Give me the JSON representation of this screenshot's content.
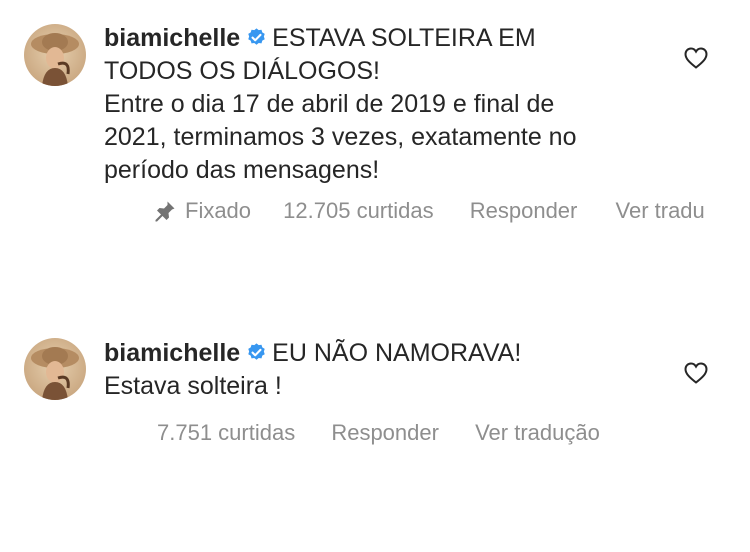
{
  "comments": [
    {
      "username": "biamichelle",
      "text_line1_tail": "ESTAVA SOLTEIRA EM",
      "text_line2": "TODOS OS DIÁLOGOS!",
      "text_line3": "Entre o dia 17 de abril de 2019 e final de",
      "text_line4": "2021, terminamos 3 vezes, exatamente no",
      "text_line5": "período das mensagens!",
      "pinned_label": "Fixado",
      "likes": "12.705 curtidas",
      "reply_label": "Responder",
      "translate_label": "Ver tradu"
    },
    {
      "username": "biamichelle",
      "text_line1_tail": "EU NÃO NAMORAVA!",
      "text_line2": "Estava solteira !",
      "likes": "7.751 curtidas",
      "reply_label": "Responder",
      "translate_label": "Ver tradução"
    }
  ],
  "colors": {
    "text": "#262626",
    "muted": "#8e8e8e",
    "verified_badge": "#3897f0"
  },
  "icons": {
    "avatar": "profile-photo",
    "verified": "verified-badge-icon",
    "like": "heart-outline-icon",
    "pin": "pin-icon"
  }
}
